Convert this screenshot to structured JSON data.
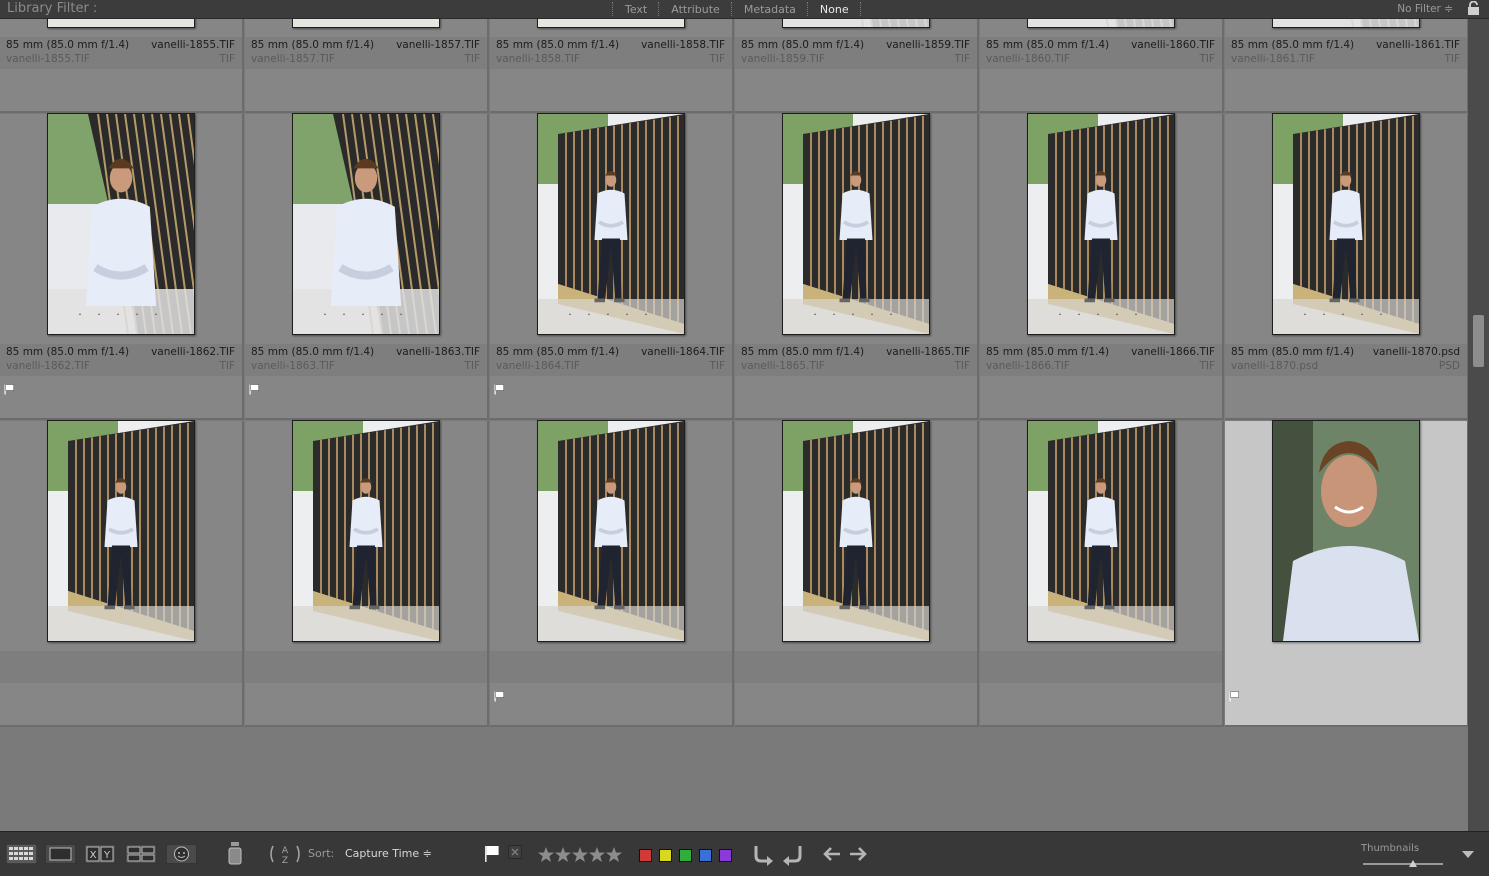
{
  "filter_bar": {
    "title": "Library Filter :",
    "tabs": [
      {
        "label": "Text",
        "active": false
      },
      {
        "label": "Attribute",
        "active": false
      },
      {
        "label": "Metadata",
        "active": false
      },
      {
        "label": "None",
        "active": true
      }
    ],
    "preset": "No Filter ≑",
    "lock_icon": "lock-icon"
  },
  "grid": {
    "photos": [
      {
        "lens": "85 mm (85.0 mm f/1.4)",
        "name": "vanelli-1855.TIF",
        "file": "vanelli-1855.TIF",
        "ext": "TIF",
        "scene": "brick",
        "flag": false,
        "rating_dots": "· · · · ·"
      },
      {
        "lens": "85 mm (85.0 mm f/1.4)",
        "name": "vanelli-1857.TIF",
        "file": "vanelli-1857.TIF",
        "ext": "TIF",
        "scene": "brick",
        "flag": false,
        "rating_dots": "· · · · ·"
      },
      {
        "lens": "85 mm (85.0 mm f/1.4)",
        "name": "vanelli-1858.TIF",
        "file": "vanelli-1858.TIF",
        "ext": "TIF",
        "scene": "brick",
        "flag": false,
        "rating_dots": "· · · · ·"
      },
      {
        "lens": "85 mm (85.0 mm f/1.4)",
        "name": "vanelli-1859.TIF",
        "file": "vanelli-1859.TIF",
        "ext": "TIF",
        "scene": "fence-close",
        "flag": false,
        "rating_dots": "· · · · ·"
      },
      {
        "lens": "85 mm (85.0 mm f/1.4)",
        "name": "vanelli-1860.TIF",
        "file": "vanelli-1860.TIF",
        "ext": "TIF",
        "scene": "fence-close",
        "flag": false,
        "rating_dots": "· · · · ·"
      },
      {
        "lens": "85 mm (85.0 mm f/1.4)",
        "name": "vanelli-1861.TIF",
        "file": "vanelli-1861.TIF",
        "ext": "TIF",
        "scene": "fence-close",
        "flag": false,
        "rating_dots": "· · · · ·"
      },
      {
        "lens": "85 mm (85.0 mm f/1.4)",
        "name": "vanelli-1862.TIF",
        "file": "vanelli-1862.TIF",
        "ext": "TIF",
        "scene": "fence-close",
        "flag": true,
        "rating_dots": "· · · · ·"
      },
      {
        "lens": "85 mm (85.0 mm f/1.4)",
        "name": "vanelli-1863.TIF",
        "file": "vanelli-1863.TIF",
        "ext": "TIF",
        "scene": "fence-close",
        "flag": true,
        "rating_dots": "· · · · ·"
      },
      {
        "lens": "85 mm (85.0 mm f/1.4)",
        "name": "vanelli-1864.TIF",
        "file": "vanelli-1864.TIF",
        "ext": "TIF",
        "scene": "fence-full",
        "flag": true,
        "rating_dots": "· · · · ·"
      },
      {
        "lens": "85 mm (85.0 mm f/1.4)",
        "name": "vanelli-1865.TIF",
        "file": "vanelli-1865.TIF",
        "ext": "TIF",
        "scene": "fence-full",
        "flag": false,
        "rating_dots": "· · · · ·"
      },
      {
        "lens": "85 mm (85.0 mm f/1.4)",
        "name": "vanelli-1866.TIF",
        "file": "vanelli-1866.TIF",
        "ext": "TIF",
        "scene": "fence-full",
        "flag": false,
        "rating_dots": "· · · · ·"
      },
      {
        "lens": "85 mm (85.0 mm f/1.4)",
        "name": "vanelli-1870.psd",
        "file": "vanelli-1870.psd",
        "ext": "PSD",
        "scene": "fence-full",
        "flag": false,
        "rating_dots": "· · · · ·"
      },
      {
        "lens": "",
        "name": "",
        "file": "",
        "ext": "",
        "scene": "fence-full",
        "flag": false,
        "rating_dots": ""
      },
      {
        "lens": "",
        "name": "",
        "file": "",
        "ext": "",
        "scene": "fence-full",
        "flag": false,
        "rating_dots": ""
      },
      {
        "lens": "",
        "name": "",
        "file": "",
        "ext": "",
        "scene": "fence-full",
        "flag": true,
        "rating_dots": ""
      },
      {
        "lens": "",
        "name": "",
        "file": "",
        "ext": "",
        "scene": "fence-full",
        "flag": false,
        "rating_dots": ""
      },
      {
        "lens": "",
        "name": "",
        "file": "",
        "ext": "",
        "scene": "fence-full",
        "flag": false,
        "rating_dots": ""
      },
      {
        "lens": "",
        "name": "",
        "file": "",
        "ext": "",
        "scene": "portrait",
        "flag": true,
        "rating_dots": "",
        "selected": true
      }
    ]
  },
  "toolbar": {
    "sort_label": "Sort:",
    "sort_value": "Capture Time ≑",
    "thumbnails_label": "Thumbnails",
    "thumbnail_size": 0.62,
    "label_colors": [
      "#d23a3a",
      "#d8d81e",
      "#2fae3a",
      "#3a6fd8",
      "#8a3ad8"
    ],
    "view_icons": [
      "grid-view-icon",
      "loupe-view-icon",
      "compare-view-icon",
      "survey-view-icon",
      "people-view-icon"
    ],
    "tool_icons": [
      "painter-icon",
      "sort-direction-icon",
      "flag-pick-icon",
      "flag-reject-icon",
      "star-rating-icon",
      "rotate-left-icon",
      "rotate-right-icon",
      "previous-icon",
      "next-icon",
      "toolbar-menu-icon"
    ]
  }
}
